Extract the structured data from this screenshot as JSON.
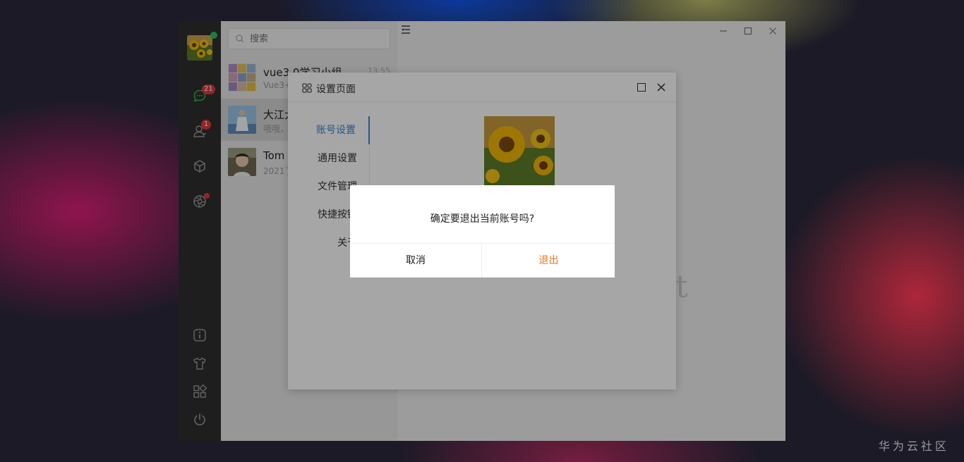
{
  "sidebar": {
    "chat_badge": "21",
    "contacts_badge": "1",
    "colors": {
      "background": "#2e2e2e",
      "online": "#22c55e",
      "badge": "#e5383b"
    }
  },
  "search": {
    "placeholder": "搜索"
  },
  "conversations": [
    {
      "name": "vue3.0学习小组",
      "preview": "Vue3+",
      "time": "13:55"
    },
    {
      "name": "大江大",
      "preview": "哦哦，"
    },
    {
      "name": "Tom",
      "preview": "2021了"
    }
  ],
  "main": {
    "brand_text": "at"
  },
  "settings": {
    "title": "设置页面",
    "nav": [
      "账号设置",
      "通用设置",
      "文件管理",
      "快捷按键",
      "关于"
    ],
    "active_index": 0,
    "accent": "#3a86d8"
  },
  "confirm_dialog": {
    "message": "确定要退出当前账号吗?",
    "cancel_label": "取消",
    "ok_label": "退出",
    "ok_color": "#e8741c"
  },
  "watermark": "华为云社区"
}
